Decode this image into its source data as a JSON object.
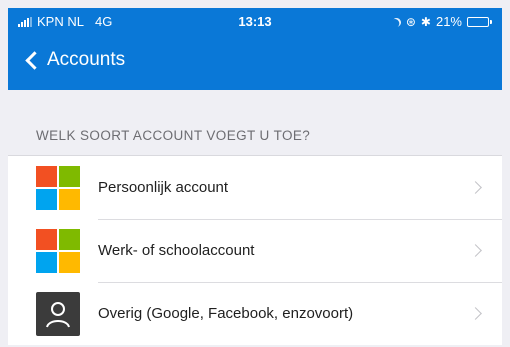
{
  "status_bar": {
    "carrier": "KPN NL",
    "network": "4G",
    "time": "13:13",
    "battery_percent": "21%",
    "battery_level": 0.21
  },
  "nav": {
    "back_label": "Accounts"
  },
  "section": {
    "title": "WELK SOORT ACCOUNT VOEGT U TOE?"
  },
  "account_types": [
    {
      "label": "Persoonlijk account",
      "icon": "microsoft-logo-icon"
    },
    {
      "label": "Werk- of schoolaccount",
      "icon": "microsoft-logo-icon"
    },
    {
      "label": "Overig (Google, Facebook, enzovoort)",
      "icon": "person-icon"
    }
  ],
  "colors": {
    "nav_blue": "#0a78d7",
    "background": "#efeff4",
    "ms_red": "#f25022",
    "ms_green": "#7fba00",
    "ms_blue": "#00a4ef",
    "ms_yellow": "#ffb900",
    "person_tile": "#3b3b3b"
  }
}
